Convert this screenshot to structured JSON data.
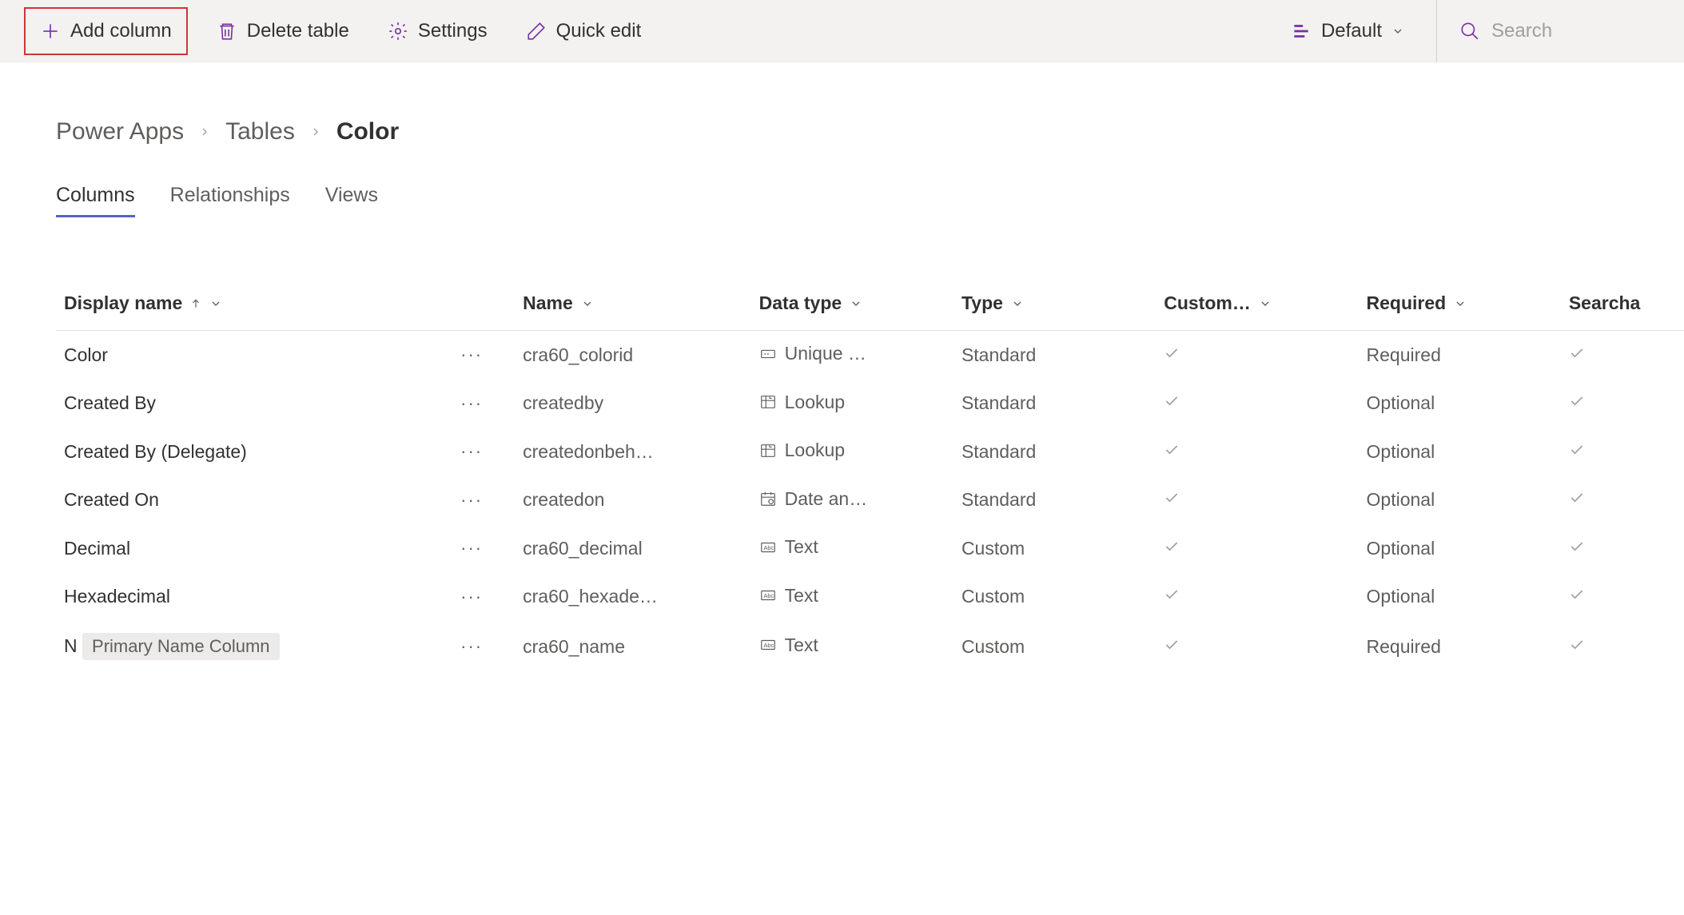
{
  "toolbar": {
    "add_column": "Add column",
    "delete_table": "Delete table",
    "settings": "Settings",
    "quick_edit": "Quick edit",
    "view_label": "Default",
    "search_placeholder": "Search"
  },
  "breadcrumb": {
    "items": [
      "Power Apps",
      "Tables"
    ],
    "current": "Color"
  },
  "tabs": {
    "items": [
      {
        "label": "Columns",
        "active": true
      },
      {
        "label": "Relationships",
        "active": false
      },
      {
        "label": "Views",
        "active": false
      }
    ]
  },
  "table": {
    "headers": {
      "display_name": "Display name",
      "name": "Name",
      "data_type": "Data type",
      "type": "Type",
      "custom": "Custom…",
      "required": "Required",
      "searchable": "Searcha"
    },
    "rows": [
      {
        "display": "Color",
        "name": "cra60_colorid",
        "datatype": "Unique …",
        "icon": "unique",
        "type": "Standard",
        "custom": true,
        "required": "Required",
        "searchable": true,
        "badge": null
      },
      {
        "display": "Created By",
        "name": "createdby",
        "datatype": "Lookup",
        "icon": "lookup",
        "type": "Standard",
        "custom": true,
        "required": "Optional",
        "searchable": true,
        "badge": null
      },
      {
        "display": "Created By (Delegate)",
        "name": "createdonbeh…",
        "datatype": "Lookup",
        "icon": "lookup",
        "type": "Standard",
        "custom": true,
        "required": "Optional",
        "searchable": true,
        "badge": null
      },
      {
        "display": "Created On",
        "name": "createdon",
        "datatype": "Date an…",
        "icon": "date",
        "type": "Standard",
        "custom": true,
        "required": "Optional",
        "searchable": true,
        "badge": null
      },
      {
        "display": "Decimal",
        "name": "cra60_decimal",
        "datatype": "Text",
        "icon": "text",
        "type": "Custom",
        "custom": true,
        "required": "Optional",
        "searchable": true,
        "badge": null
      },
      {
        "display": "Hexadecimal",
        "name": "cra60_hexade…",
        "datatype": "Text",
        "icon": "text",
        "type": "Custom",
        "custom": true,
        "required": "Optional",
        "searchable": true,
        "badge": null
      },
      {
        "display": "N",
        "name": "cra60_name",
        "datatype": "Text",
        "icon": "text",
        "type": "Custom",
        "custom": true,
        "required": "Required",
        "searchable": true,
        "badge": "Primary Name Column"
      }
    ]
  }
}
